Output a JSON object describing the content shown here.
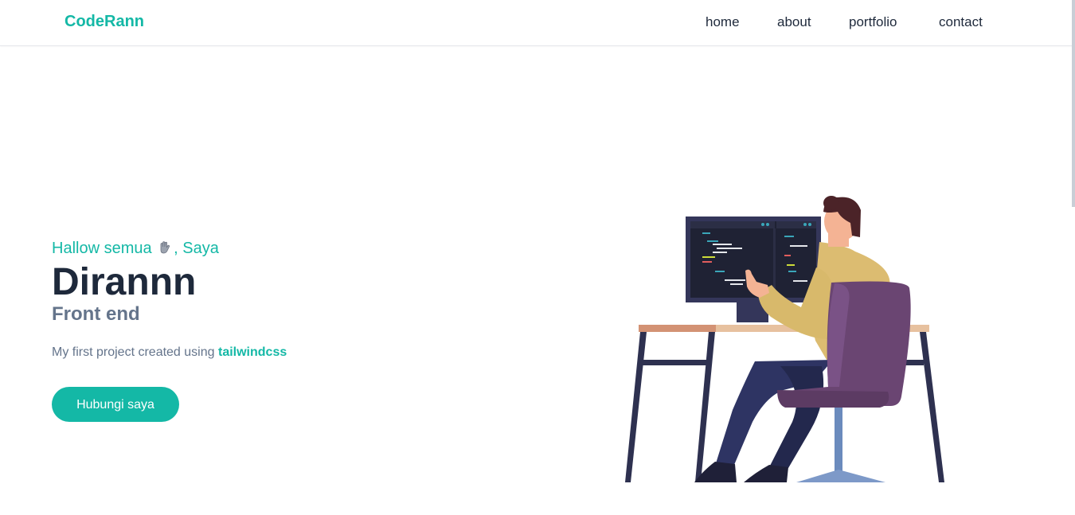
{
  "header": {
    "brand": "CodeRann",
    "nav": [
      "home",
      "about",
      "portfolio",
      "contact"
    ]
  },
  "hero": {
    "greeting_prefix": "Hallow semua",
    "greeting_suffix": ", Saya",
    "name": "Dirannn",
    "role": "Front end",
    "description": "My first project created using",
    "highlight": "tailwindcss",
    "cta": "Hubungi saya"
  },
  "colors": {
    "primary": "#14b8a6",
    "dark": "#1e293b",
    "secondary": "#64748b"
  },
  "illustration": {
    "icon": "developer-at-desk-illustration"
  }
}
